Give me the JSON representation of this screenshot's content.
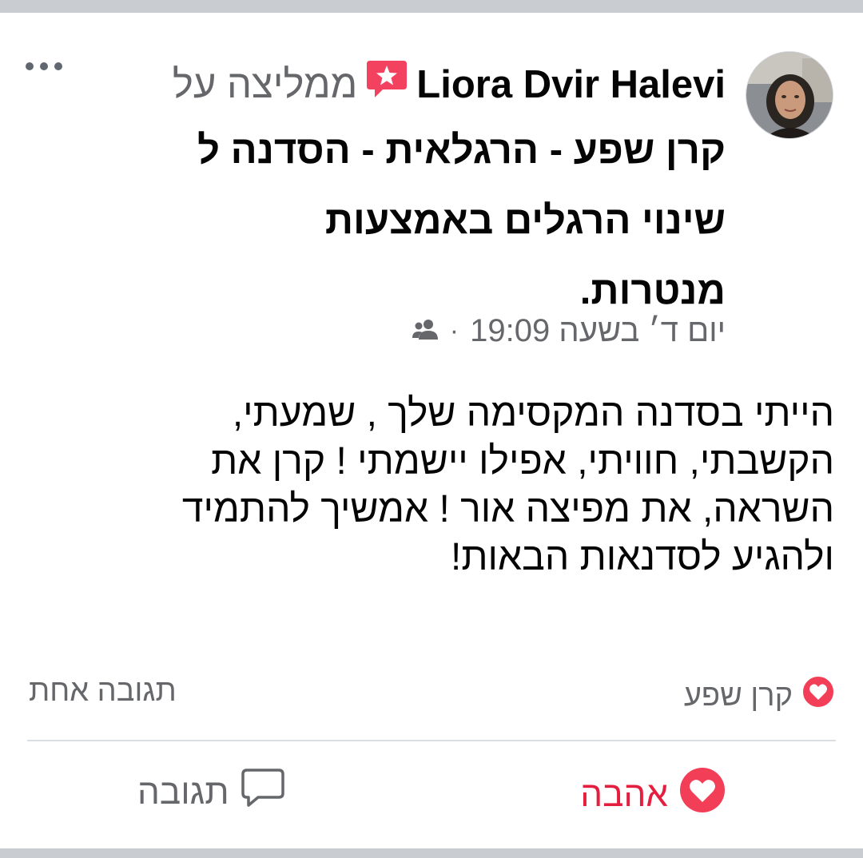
{
  "post": {
    "author": "Liora Dvir Halevi",
    "recommends_text": "ממליצה על",
    "page_name": "קרן שפע - הרגלאית - הסדנה ל שינוי הרגלים באמצעות מנטרות.",
    "page_line1": "קרן שפע - הרגלאית - הסדנה ל",
    "page_line2": "שינוי הרגלים באמצעות",
    "page_line3": "מנטרות.",
    "timestamp": "יום ד׳ בשעה 19:09",
    "separator": "·",
    "audience_icon": "friends-icon",
    "body_line1": "הייתי בסדנה המקסימה שלך , שמעתי,",
    "body_line2": "הקשבתי, חוויתי, אפילו יישמתי ! קרן את",
    "body_line3": "השראה, את מפיצה אור ! אמשיך להתמיד",
    "body_line4": "ולהגיע לסדנאות הבאות!"
  },
  "reactions": {
    "reactor_name": "קרן שפע",
    "comment_count_text": "תגובה אחת"
  },
  "actions": {
    "love_label": "אהבה",
    "reply_label": "תגובה"
  },
  "colors": {
    "love_red": "#e41e3f",
    "secondary_text": "#65676b",
    "recommend_badge": "#f3425f"
  }
}
